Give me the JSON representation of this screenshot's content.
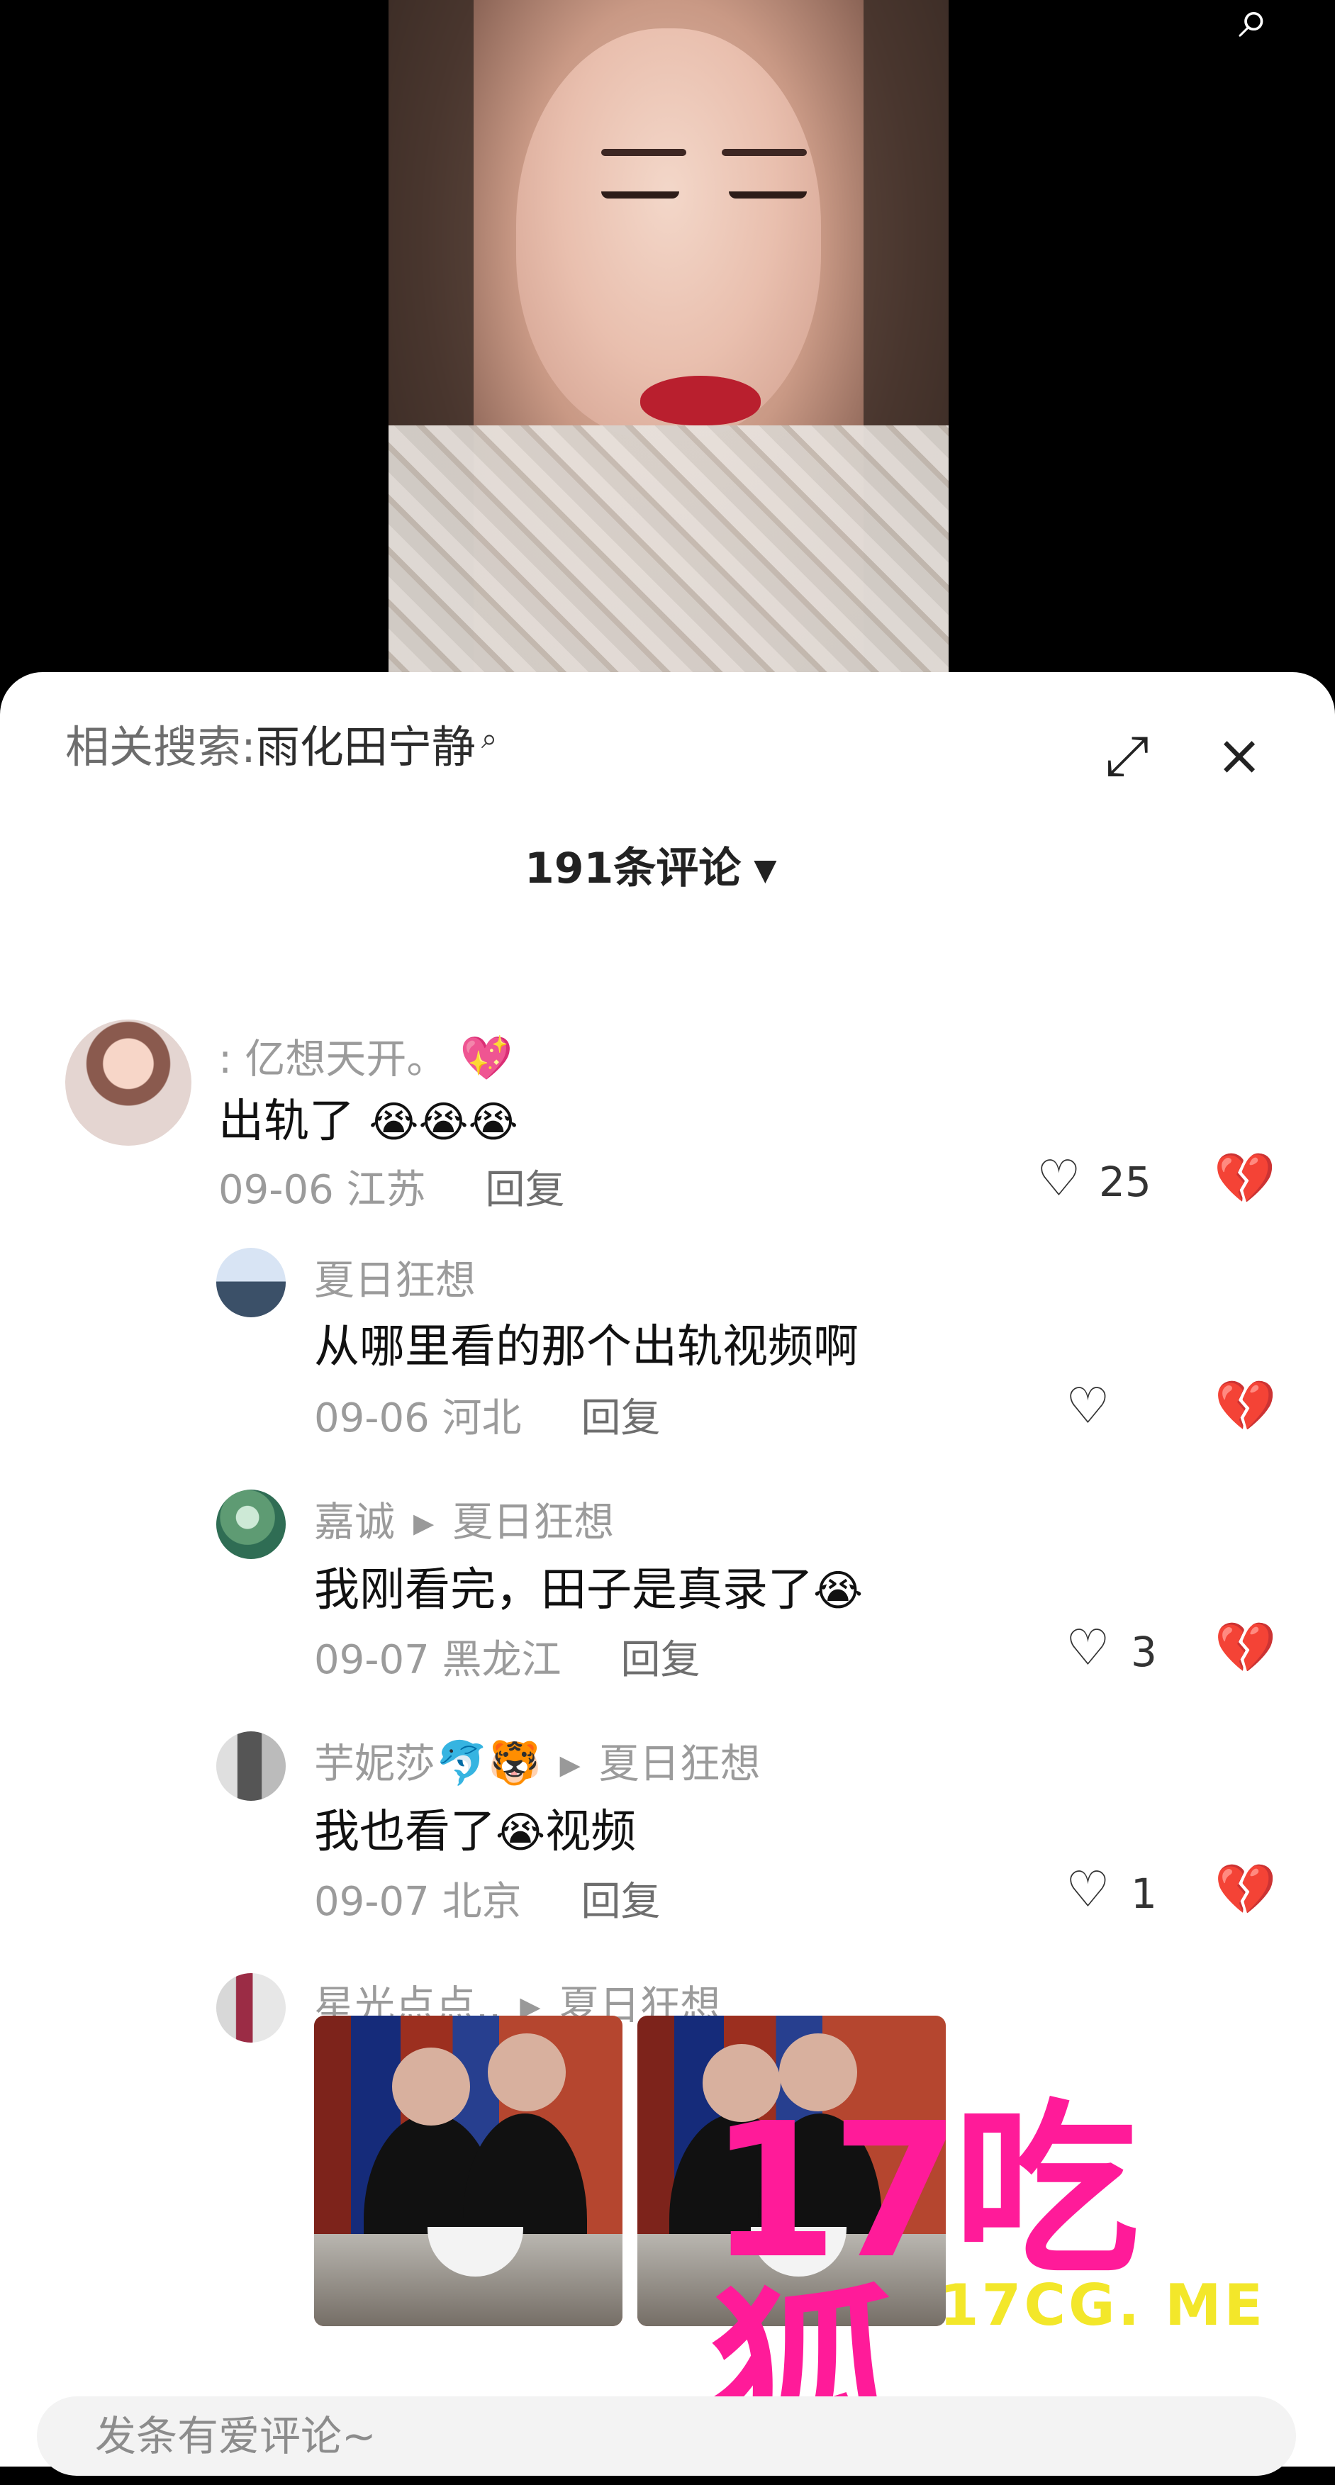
{
  "top": {
    "search_icon": "search-icon"
  },
  "sheet": {
    "related_prefix": "相关搜索:",
    "related_keyword": "雨化田宁静",
    "related_icon": "search-icon",
    "expand_icon": "expand-icon",
    "close_icon": "close-icon",
    "comment_count": "191条评论"
  },
  "comments": [
    {
      "name": "亿想天开。",
      "text": "出轨了",
      "date": "09-06",
      "location": "江苏",
      "reply": "回复",
      "likes": "25"
    },
    {
      "name": "夏日狂想",
      "text": "从哪里看的那个出轨视频啊",
      "date": "09-06",
      "location": "河北",
      "reply": "回复"
    },
    {
      "name": "嘉诚",
      "to": "夏日狂想",
      "text": "我刚看完，田子是真录了",
      "date": "09-07",
      "location": "黑龙江",
      "reply": "回复",
      "likes": "3"
    },
    {
      "name": "芋妮莎",
      "to": "夏日狂想",
      "text_before": "我也看了",
      "text_after": "视频",
      "date": "09-07",
      "location": "北京",
      "reply": "回复",
      "likes": "1"
    },
    {
      "name": "星光点点..",
      "to": "夏日狂想"
    }
  ],
  "watermark": {
    "logo": "17吃狐",
    "site": "17CG. ME"
  },
  "input": {
    "placeholder": "发条有爱评论~"
  }
}
